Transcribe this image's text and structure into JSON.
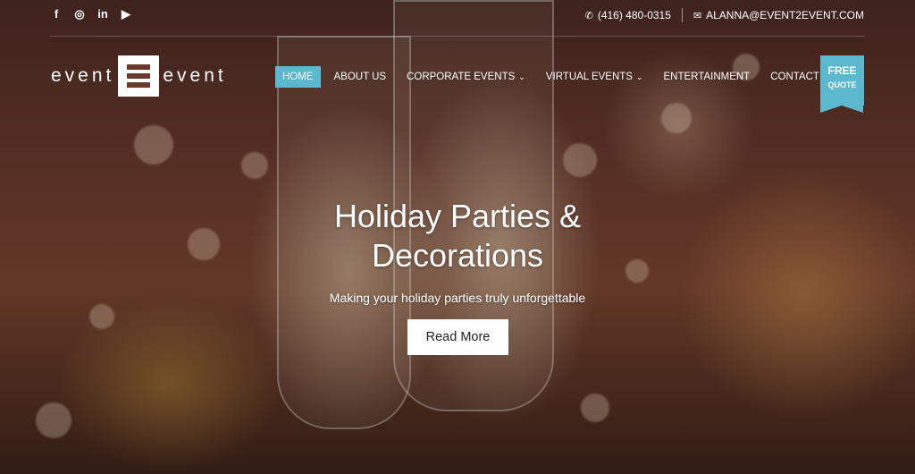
{
  "topbar": {
    "social": [
      {
        "icon": "facebook-icon",
        "glyph": "f"
      },
      {
        "icon": "instagram-icon",
        "glyph": "◎"
      },
      {
        "icon": "linkedin-icon",
        "glyph": "in"
      },
      {
        "icon": "youtube-icon",
        "glyph": "▶"
      }
    ],
    "phone": "(416) 480-0315",
    "email": "ALANNA@EVENT2EVENT.COM"
  },
  "logo": {
    "left": "event",
    "right": "event"
  },
  "nav": {
    "home": "HOME",
    "about": "ABOUT US",
    "corporate": "CORPORATE EVENTS",
    "virtual": "VIRTUAL EVENTS",
    "entertainment": "ENTERTAINMENT",
    "contact": "CONTACT US"
  },
  "quote": {
    "line1": "FREE",
    "line2": "QUOTE"
  },
  "hero": {
    "headline_1": "Holiday Parties &",
    "headline_2": "Decorations",
    "subline": "Making your holiday parties truly unforgettable",
    "cta": "Read More"
  },
  "colors": {
    "accent": "#5bb8cf"
  }
}
